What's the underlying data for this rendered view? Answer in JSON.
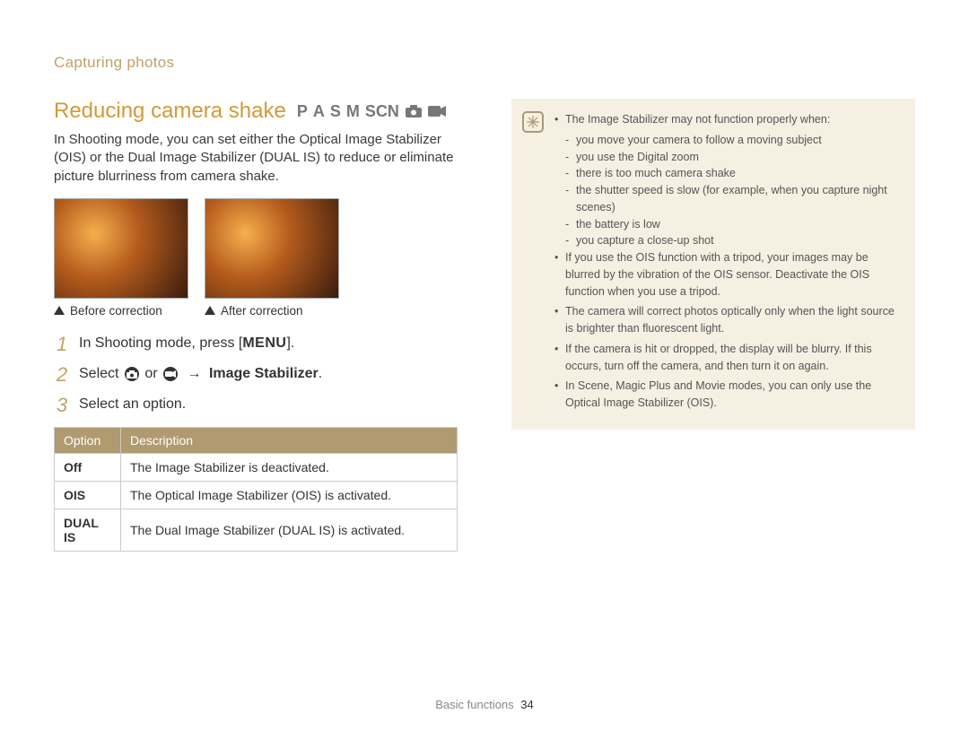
{
  "breadcrumb": "Capturing photos",
  "title": "Reducing camera shake",
  "modes": [
    "P",
    "A",
    "S",
    "M",
    "SCN",
    "camera-icon",
    "video-icon"
  ],
  "intro": "In Shooting mode, you can set either the Optical Image Stabilizer (OIS) or the Dual Image Stabilizer (DUAL IS) to reduce or eliminate picture blurriness from camera shake.",
  "captions": {
    "before": "Before correction",
    "after": "After correction"
  },
  "steps": {
    "s1_pre": "In Shooting mode, press [",
    "s1_menu": "MENU",
    "s1_post": "].",
    "s2_pre": "Select ",
    "s2_or": " or ",
    "s2_arrow": " → ",
    "s2_bold": "Image Stabilizer",
    "s2_post": ".",
    "s3": "Select an option."
  },
  "table": {
    "headers": {
      "option": "Option",
      "description": "Description"
    },
    "rows": [
      {
        "option": "Off",
        "desc": "The Image Stabilizer is deactivated."
      },
      {
        "option": "OIS",
        "desc": "The Optical Image Stabilizer (OIS) is activated."
      },
      {
        "option": "DUAL IS",
        "desc": "The Dual Image Stabilizer (DUAL IS) is activated."
      }
    ]
  },
  "note": {
    "lines": [
      {
        "lvl": "top",
        "t": "The Image Stabilizer may not function properly when:"
      },
      {
        "lvl": "sub",
        "t": "you move your camera to follow a moving subject"
      },
      {
        "lvl": "sub",
        "t": "you use the Digital zoom"
      },
      {
        "lvl": "sub",
        "t": "there is too much camera shake"
      },
      {
        "lvl": "sub",
        "t": "the shutter speed is slow (for example, when you capture night scenes)"
      },
      {
        "lvl": "sub",
        "t": "the battery is low"
      },
      {
        "lvl": "sub",
        "t": "you capture a close-up shot"
      },
      {
        "lvl": "top",
        "t": "If you use the OIS function with a tripod, your images may be blurred by the vibration of the OIS sensor. Deactivate the OIS function when you use a tripod."
      },
      {
        "lvl": "top",
        "t": "The camera will correct photos optically only when the light source is brighter than fluorescent light."
      },
      {
        "lvl": "top",
        "t": "If the camera is hit or dropped, the display will be blurry. If this occurs, turn off the camera, and then turn it on again."
      },
      {
        "lvl": "top",
        "t": "In Scene, Magic Plus and Movie modes, you can only use the Optical Image Stabilizer (OIS)."
      }
    ]
  },
  "footer": {
    "section": "Basic functions",
    "page": "34"
  }
}
